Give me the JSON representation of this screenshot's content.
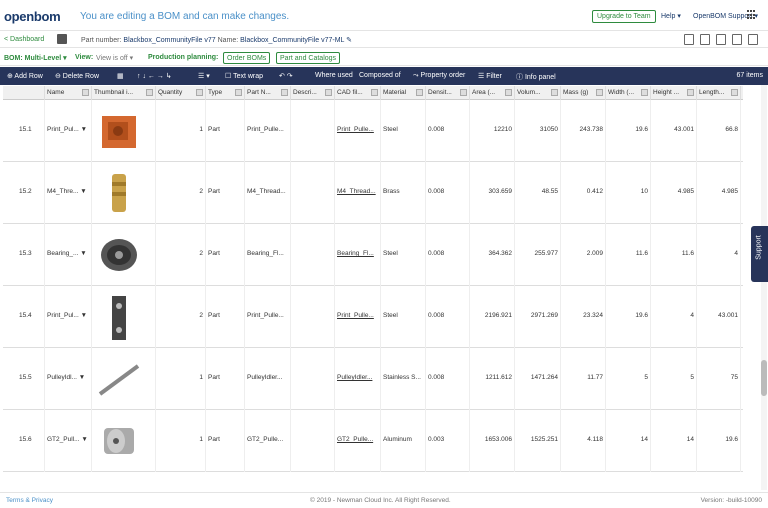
{
  "header": {
    "logo": "openbom",
    "edit_message": "You are editing a BOM and can make changes.",
    "upgrade": "Upgrade to Team",
    "help": "Help ▾",
    "support": "OpenBOM Support ▾"
  },
  "crumb": {
    "dashboard": "< Dashboard",
    "part_number_label": "Part number:",
    "part_number": "Blackbox_CommunityFile v77",
    "name_label": "Name:",
    "name": "Blackbox_CommunityFile v77-ML ✎"
  },
  "bar": {
    "bom": "BOM: Multi-Level ▾",
    "view": "View:",
    "view_value": "View is off ▾",
    "planning": "Production planning:",
    "order_boms": "Order BOMs",
    "part_catalogs": "Part and Catalogs"
  },
  "toolbar": {
    "add_row": "⊕ Add Row",
    "delete_row": "⊖ Delete Row",
    "text_wrap": "Text wrap",
    "where_used": "Where used",
    "composed_of": "Composed of",
    "property_order": "Property order",
    "filter": "Filter",
    "info_panel": "Info panel",
    "items": "67 items"
  },
  "columns": [
    "",
    "Name",
    "Thumbnail i...",
    "Quantity",
    "Type",
    "Part N...",
    "Descri...",
    "CAD fil...",
    "Material",
    "Densit...",
    "Area (...",
    "Volum...",
    "Mass (g)",
    "Width (...",
    "Height ...",
    "Length..."
  ],
  "rows": [
    {
      "id": "15.1",
      "name": "Print_Pul...",
      "qty": "1",
      "type": "Part",
      "pn": "Print_Pulle...",
      "desc": "",
      "cad": "Print_Pulle...",
      "mat": "Steel",
      "dens": "0.008",
      "area": "12210",
      "vol": "31050",
      "mass": "243.738",
      "w": "19.6",
      "h": "43.001",
      "l": "66.8"
    },
    {
      "id": "15.2",
      "name": "M4_Thre...",
      "qty": "2",
      "type": "Part",
      "pn": "M4_Thread...",
      "desc": "",
      "cad": "M4_Thread...",
      "mat": "Brass",
      "dens": "0.008",
      "area": "303.659",
      "vol": "48.55",
      "mass": "0.412",
      "w": "10",
      "h": "4.985",
      "l": "4.985"
    },
    {
      "id": "15.3",
      "name": "Bearing_...",
      "qty": "2",
      "type": "Part",
      "pn": "Bearing_Fl...",
      "desc": "",
      "cad": "Bearing_Fl...",
      "mat": "Steel",
      "dens": "0.008",
      "area": "364.362",
      "vol": "255.977",
      "mass": "2.009",
      "w": "11.6",
      "h": "11.6",
      "l": "4"
    },
    {
      "id": "15.4",
      "name": "Print_Pul...",
      "qty": "2",
      "type": "Part",
      "pn": "Print_Pulle...",
      "desc": "",
      "cad": "Print_Pulle...",
      "mat": "Steel",
      "dens": "0.008",
      "area": "2196.921",
      "vol": "2971.269",
      "mass": "23.324",
      "w": "19.6",
      "h": "4",
      "l": "43.001"
    },
    {
      "id": "15.5",
      "name": "PulleyIdl...",
      "qty": "1",
      "type": "Part",
      "pn": "PulleyIdler...",
      "desc": "",
      "cad": "PulleyIdler...",
      "mat": "Stainless S...",
      "dens": "0.008",
      "area": "1211.612",
      "vol": "1471.264",
      "mass": "11.77",
      "w": "5",
      "h": "5",
      "l": "75"
    },
    {
      "id": "15.6",
      "name": "GT2_Pull...",
      "qty": "1",
      "type": "Part",
      "pn": "GT2_Pulle...",
      "desc": "",
      "cad": "GT2_Pulle...",
      "mat": "Aluminum",
      "dens": "0.003",
      "area": "1653.006",
      "vol": "1525.251",
      "mass": "4.118",
      "w": "14",
      "h": "14",
      "l": "19.6"
    }
  ],
  "side_tab": "Support",
  "footer": {
    "terms": "Terms & Privacy",
    "copyright": "© 2019 - Newman Cloud Inc. All Right Reserved.",
    "version": "Version: -build-10090"
  }
}
